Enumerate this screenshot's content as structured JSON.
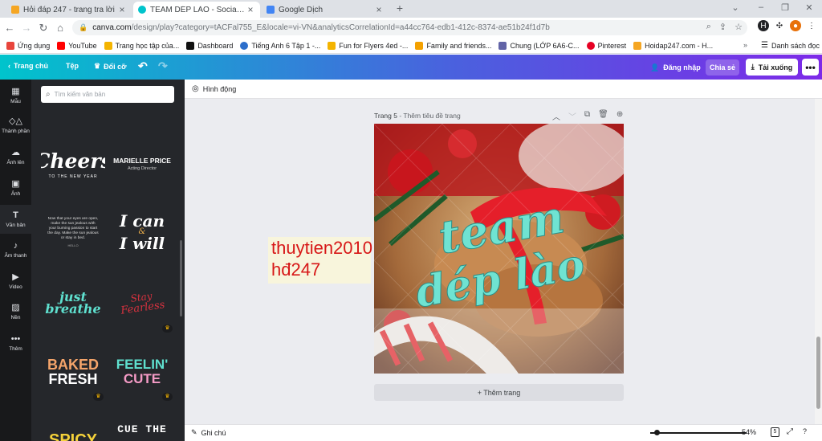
{
  "browser": {
    "tabs": [
      {
        "title": "Hỏi đáp 247 - trang tra lời",
        "favicon_color": "#f5a623"
      },
      {
        "title": "TEAM DÉP LÀO - Social Media",
        "favicon_color": "#00c4cc"
      },
      {
        "title": "Google Dịch",
        "favicon_color": "#4285f4"
      }
    ],
    "new_tab": "+",
    "url_host": "canva.com",
    "url_path": "/design/play?category=tACFal755_E&locale=vi-VN&analyticsCorrelationId=a44cc764-edb1-412c-8374-ae51b24f1d7b",
    "bookmarks": [
      {
        "label": "Ứng dụng",
        "color": "#e8453c"
      },
      {
        "label": "YouTube",
        "color": "#ff0000"
      },
      {
        "label": "Trang học tập của...",
        "color": "#f4b400"
      },
      {
        "label": "Dashboard",
        "color": "#111111"
      },
      {
        "label": "Tiếng Anh 6 Tập 1 -...",
        "color": "#2c6ecb"
      },
      {
        "label": "Fun for Flyers 4ed -...",
        "color": "#f4b400"
      },
      {
        "label": "Family and friends...",
        "color": "#f4a100"
      },
      {
        "label": "Chung (LỚP 6A6-C...",
        "color": "#6264a7"
      },
      {
        "label": "Pinterest",
        "color": "#e60023"
      },
      {
        "label": "Hoidap247.com - H...",
        "color": "#f5a623"
      }
    ],
    "bookmarks_more": "»",
    "reading_list": "Danh sách đọc"
  },
  "canva_header": {
    "home": "Trang chủ",
    "file": "Tệp",
    "resize": "Đổi cỡ",
    "login": "Đăng nhập",
    "share": "Chia sẻ",
    "download": "Tải xuống",
    "more": "•••"
  },
  "rail": [
    {
      "label": "Mẫu",
      "icon": "layout-icon"
    },
    {
      "label": "Thành phần",
      "icon": "elements-icon"
    },
    {
      "label": "Ảnh lên",
      "icon": "upload-icon"
    },
    {
      "label": "Ảnh",
      "icon": "photo-icon"
    },
    {
      "label": "Văn bản",
      "icon": "text-icon"
    },
    {
      "label": "Âm thanh",
      "icon": "music-icon"
    },
    {
      "label": "Video",
      "icon": "video-icon"
    },
    {
      "label": "Nền",
      "icon": "background-icon"
    },
    {
      "label": "Thêm",
      "icon": "more-icon"
    }
  ],
  "panel": {
    "search_placeholder": "Tìm kiếm văn bản",
    "t_cheers_main": "Cheers",
    "t_cheers_sub": "TO THE NEW YEAR",
    "t_marielle_name": "MARIELLE PRICE",
    "t_marielle_role": "Acting Director",
    "t_para": "Now that your eyes are open, make the sun jealous with your burning passion to start the day. Make the sun jealous or stay in bed.",
    "t_para_sign": "HELLO",
    "t_icanwill_1": "I can",
    "t_icanwill_amp": "&",
    "t_icanwill_2": "I will",
    "t_breathe_1": "just",
    "t_breathe_2": "breathe",
    "t_fearless_1": "Stay",
    "t_fearless_2": "Fearless",
    "t_baked_1": "BAKED",
    "t_baked_2": "FRESH",
    "t_feelin_1": "FEELIN'",
    "t_feelin_2": "CUTE",
    "t_cue": "CUE THE",
    "t_spicy": "SPICY"
  },
  "editor": {
    "animate": "Hình động",
    "page_label_num": "Trang 5",
    "page_label_title": " - Thêm tiêu đề trang",
    "design_line1": "team",
    "design_line2": "dép lào",
    "overlay_line1": "thuytien2010",
    "overlay_line2": "hđ247",
    "add_page": "+ Thêm trang",
    "notes": "Ghi chú",
    "zoom_label": "54%",
    "zoom_value": 0.54,
    "page_count": "5"
  }
}
